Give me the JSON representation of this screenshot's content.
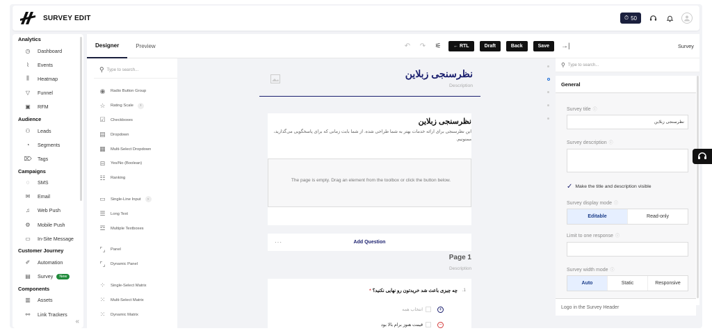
{
  "header": {
    "title": "SURVEY EDIT",
    "credits": "50"
  },
  "sidebar": {
    "sections": [
      {
        "title": "Analytics",
        "items": [
          {
            "label": "Dashboard",
            "icon": "dashboard-icon"
          },
          {
            "label": "Events",
            "icon": "events-icon"
          },
          {
            "label": "Heatmap",
            "icon": "heatmap-icon"
          },
          {
            "label": "Funnel",
            "icon": "funnel-icon"
          },
          {
            "label": "RFM",
            "icon": "rfm-icon"
          }
        ]
      },
      {
        "title": "Audience",
        "items": [
          {
            "label": "Leads",
            "icon": "leads-icon"
          },
          {
            "label": "Segments",
            "icon": "segments-icon"
          },
          {
            "label": "Tags",
            "icon": "tags-icon"
          }
        ]
      },
      {
        "title": "Campaigns",
        "items": [
          {
            "label": "SMS",
            "icon": "sms-icon"
          },
          {
            "label": "Email",
            "icon": "email-icon"
          },
          {
            "label": "Web Push",
            "icon": "web-push-icon"
          },
          {
            "label": "Mobile Push",
            "icon": "mobile-push-icon"
          },
          {
            "label": "In-Site Message",
            "icon": "in-site-message-icon"
          }
        ]
      },
      {
        "title": "Customer Journey",
        "items": [
          {
            "label": "Automation",
            "icon": "automation-icon"
          },
          {
            "label": "Survey",
            "icon": "survey-icon",
            "badge": "New"
          }
        ]
      },
      {
        "title": "Components",
        "items": [
          {
            "label": "Assets",
            "icon": "assets-icon"
          },
          {
            "label": "Link Trackers",
            "icon": "link-icon"
          }
        ]
      }
    ]
  },
  "designer": {
    "tabs": [
      "Designer",
      "Preview"
    ],
    "buttons": {
      "rtl": "← RTL",
      "draft": "Draft",
      "back": "Back",
      "save": "Save"
    }
  },
  "toolbox": {
    "search_placeholder": "Type to search...",
    "items": [
      {
        "label": "Radio Button Group",
        "icon": "radio-icon"
      },
      {
        "label": "Rating Scale",
        "icon": "star-icon",
        "more": true
      },
      {
        "label": "Checkboxes",
        "icon": "checkbox-icon"
      },
      {
        "label": "Dropdown",
        "icon": "dropdown-icon"
      },
      {
        "label": "Multi-Select Dropdown",
        "icon": "multi-dropdown-icon"
      },
      {
        "label": "Yes/No (Boolean)",
        "icon": "boolean-icon"
      },
      {
        "label": "Ranking",
        "icon": "ranking-icon"
      },
      {
        "label": "Single-Line Input",
        "icon": "single-input-icon",
        "more": true,
        "gap": true
      },
      {
        "label": "Long Text",
        "icon": "long-text-icon"
      },
      {
        "label": "Multiple Textboxes",
        "icon": "multi-textbox-icon"
      },
      {
        "label": "Panel",
        "icon": "panel-icon",
        "gap": true
      },
      {
        "label": "Dynamic Panel",
        "icon": "dynamic-panel-icon"
      },
      {
        "label": "Single-Select Matrix",
        "icon": "single-matrix-icon",
        "gap": true
      },
      {
        "label": "Multi-Select Matrix",
        "icon": "multi-matrix-icon"
      },
      {
        "label": "Dynamic Matrix",
        "icon": "dynamic-matrix-icon"
      }
    ]
  },
  "canvas": {
    "survey_title": "نظرسنجی زبلاین",
    "description_placeholder": "Description",
    "page_title": "نظرسنجی زبلاین",
    "page_description": "این نظرسنجی برای ارائه خدمات بهتر به شما طراحی شده. از شما بابت زمانی که برای پاسخگویی می‌گذارید، ممنونیم.",
    "empty_text": "The page is empty. Drag an element from the toolbox or click the button below.",
    "add_question": "Add Question",
    "page1_title": "Page 1",
    "page1_description": "Description",
    "question": {
      "number": ".1",
      "title": "چه چیزی باعث شد خریدتون رو نهایی نکنید؟",
      "required": "*",
      "options": [
        "انتخاب همه",
        "قیمت هنوز برام بالا بود"
      ]
    }
  },
  "properties": {
    "header_label": "Survey",
    "search_placeholder": "Type to search...",
    "section": "General",
    "survey_title_label": "Survey title",
    "survey_title_value": "نظرسنجی زبلاین",
    "survey_description_label": "Survey description",
    "visible_check": "Make the title and description visible",
    "display_mode_label": "Survey display mode",
    "display_modes": [
      "Editable",
      "Read-only"
    ],
    "limit_label": "Limit to one response",
    "width_mode_label": "Survey width mode",
    "width_modes": [
      "Auto",
      "Static",
      "Responsive"
    ],
    "logo_label": "Logo in the Survey Header"
  }
}
